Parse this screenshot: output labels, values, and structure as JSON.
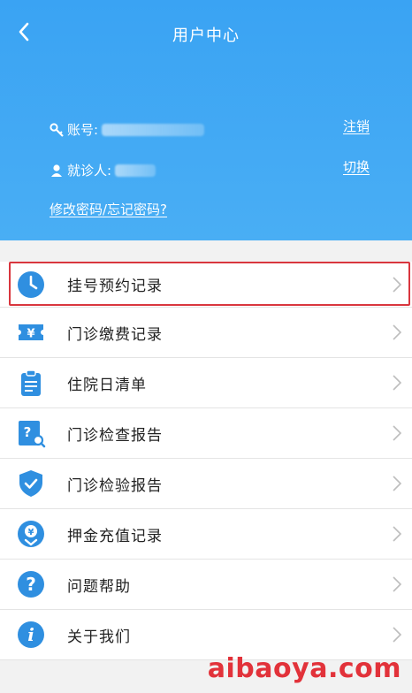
{
  "header": {
    "title": "用户中心",
    "account_label": "账号:",
    "patient_label": "就诊人:",
    "logout_label": "注销",
    "switch_label": "切换",
    "password_link": "修改密码/忘记密码?"
  },
  "menu": {
    "items": [
      {
        "label": "挂号预约记录",
        "icon": "clock-icon"
      },
      {
        "label": "门诊缴费记录",
        "icon": "ticket-yen-icon"
      },
      {
        "label": "住院日清单",
        "icon": "clipboard-icon"
      },
      {
        "label": "门诊检查报告",
        "icon": "report-search-icon"
      },
      {
        "label": "门诊检验报告",
        "icon": "shield-check-icon"
      },
      {
        "label": "押金充值记录",
        "icon": "yen-download-icon"
      },
      {
        "label": "问题帮助",
        "icon": "question-icon"
      },
      {
        "label": "关于我们",
        "icon": "info-icon"
      }
    ]
  },
  "colors": {
    "header_bg": "#3aa3f3",
    "icon_blue": "#2f8fe0",
    "highlight": "#d9363e"
  },
  "watermark": "aibaoya.com"
}
